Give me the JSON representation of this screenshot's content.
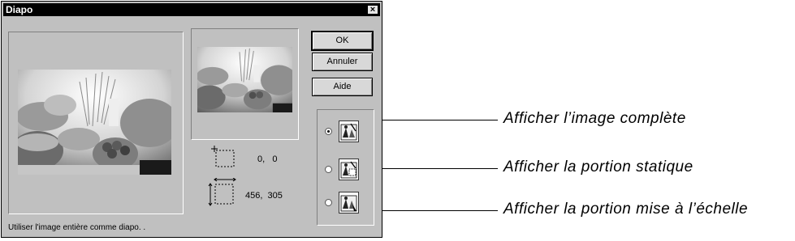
{
  "window": {
    "title": "Diapo",
    "close_symbol": "×"
  },
  "buttons": {
    "ok": "OK",
    "cancel": "Annuler",
    "help": "Aide"
  },
  "coords": {
    "origin": "0,   0",
    "size": "456,  305"
  },
  "options": [
    {
      "icon": "full-image-icon",
      "checked": true
    },
    {
      "icon": "static-portion-icon",
      "checked": false
    },
    {
      "icon": "scaled-portion-icon",
      "checked": false
    }
  ],
  "status_text": "Utiliser l'image entière comme diapo.  .",
  "callouts": [
    "Afficher l’image complète",
    "Afficher la portion statique",
    "Afficher la portion mise à l’échelle"
  ]
}
